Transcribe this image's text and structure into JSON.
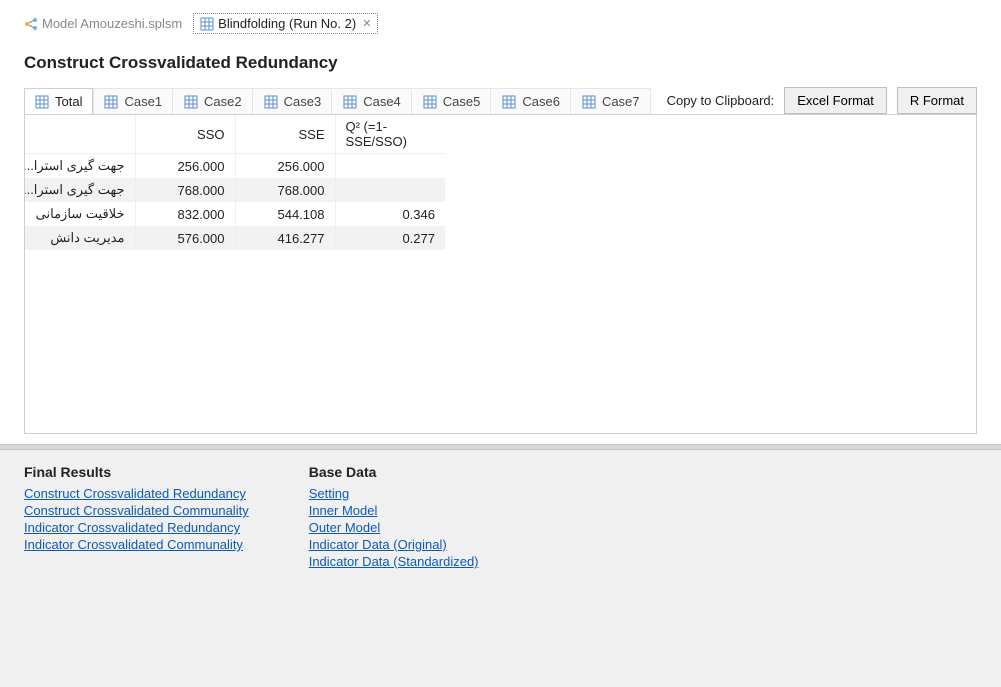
{
  "editor_tabs": [
    {
      "label": "Model Amouzeshi.splsm",
      "active": false
    },
    {
      "label": "Blindfolding (Run No. 2)",
      "active": true
    }
  ],
  "heading": "Construct Crossvalidated Redundancy",
  "case_tabs": [
    "Total",
    "Case1",
    "Case2",
    "Case3",
    "Case4",
    "Case5",
    "Case6",
    "Case7"
  ],
  "active_case_tab": 0,
  "clipboard_label": "Copy to Clipboard:",
  "btn_excel": "Excel Format",
  "btn_r": "R Format",
  "table": {
    "headers": [
      "",
      "SSO",
      "SSE",
      "Q² (=1-SSE/SSO)"
    ],
    "rows": [
      {
        "name": "جهت گیری استرا...",
        "sso": "256.000",
        "sse": "256.000",
        "q2": ""
      },
      {
        "name": "جهت گیری استرا...",
        "sso": "768.000",
        "sse": "768.000",
        "q2": ""
      },
      {
        "name": "خلاقیت سازمانی",
        "sso": "832.000",
        "sse": "544.108",
        "q2": "0.346"
      },
      {
        "name": "مدیریت دانش",
        "sso": "576.000",
        "sse": "416.277",
        "q2": "0.277"
      }
    ]
  },
  "bottom": {
    "final_results": {
      "title": "Final Results",
      "links": [
        "Construct Crossvalidated Redundancy",
        "Construct Crossvalidated Communality",
        "Indicator Crossvalidated Redundancy",
        "Indicator Crossvalidated Communality"
      ]
    },
    "base_data": {
      "title": "Base Data",
      "links": [
        "Setting",
        "Inner Model",
        "Outer Model",
        "Indicator Data (Original)",
        "Indicator Data (Standardized)"
      ]
    }
  }
}
